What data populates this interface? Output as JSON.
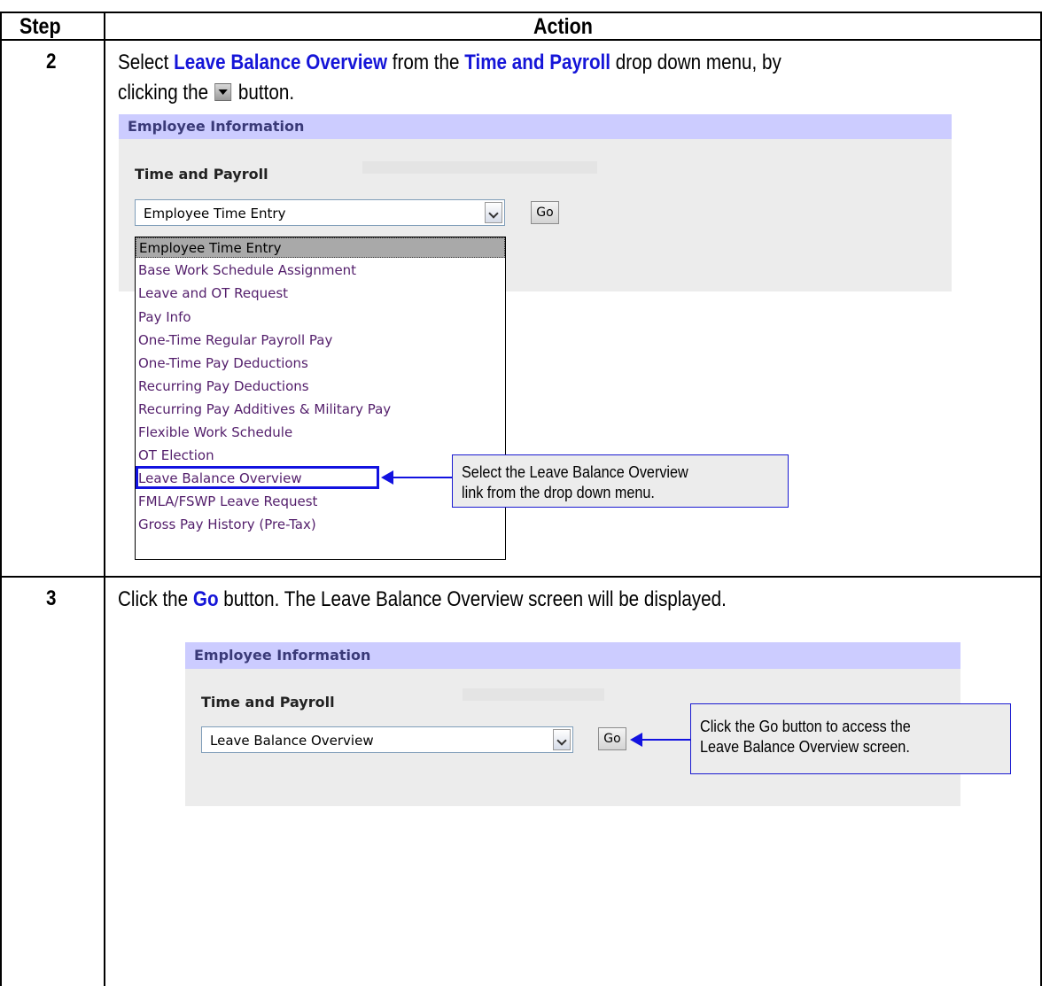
{
  "table": {
    "header_step": "Step",
    "header_action": "Action"
  },
  "step2": {
    "number": "2",
    "text_select": "Select ",
    "link_leave_balance": "Leave Balance Overview",
    "text_from_the": " from the ",
    "link_time_payroll": "Time and Payroll",
    "text_dropdown_menu": " drop down menu, by",
    "text_clicking_the": "clicking the ",
    "text_button": " button.",
    "panel": {
      "title": "Employee Information",
      "label": "Time and Payroll",
      "select_value": "Employee Time Entry",
      "go_label": "Go"
    },
    "dropdown_items": [
      "Employee Time Entry",
      "Base Work Schedule Assignment",
      "Leave and OT Request",
      "Pay Info",
      "One-Time Regular Payroll Pay",
      "One-Time Pay Deductions",
      "Recurring Pay Deductions",
      "Recurring Pay Additives & Military Pay",
      "Flexible Work Schedule",
      "OT Election",
      "Leave Balance Overview",
      "FMLA/FSWP Leave Request",
      "Gross Pay History (Pre-Tax)"
    ],
    "callout_line1": "Select the Leave Balance Overview",
    "callout_line2": "link from the drop down menu."
  },
  "step3": {
    "number": "3",
    "text_click_the": "Click the ",
    "link_go": "Go",
    "text_rest": " button.  The Leave Balance Overview screen will be displayed.",
    "panel": {
      "title": "Employee Information",
      "label": "Time and Payroll",
      "select_value": "Leave Balance Overview",
      "go_label": "Go"
    },
    "callout_line1": "Click the Go button to access the",
    "callout_line2": "Leave Balance Overview screen."
  },
  "colors": {
    "highlight_blue": "#1515d8",
    "panel_header": "#ccccff",
    "panel_bg": "#ececec",
    "dropdown_item_text": "#531e6b"
  }
}
